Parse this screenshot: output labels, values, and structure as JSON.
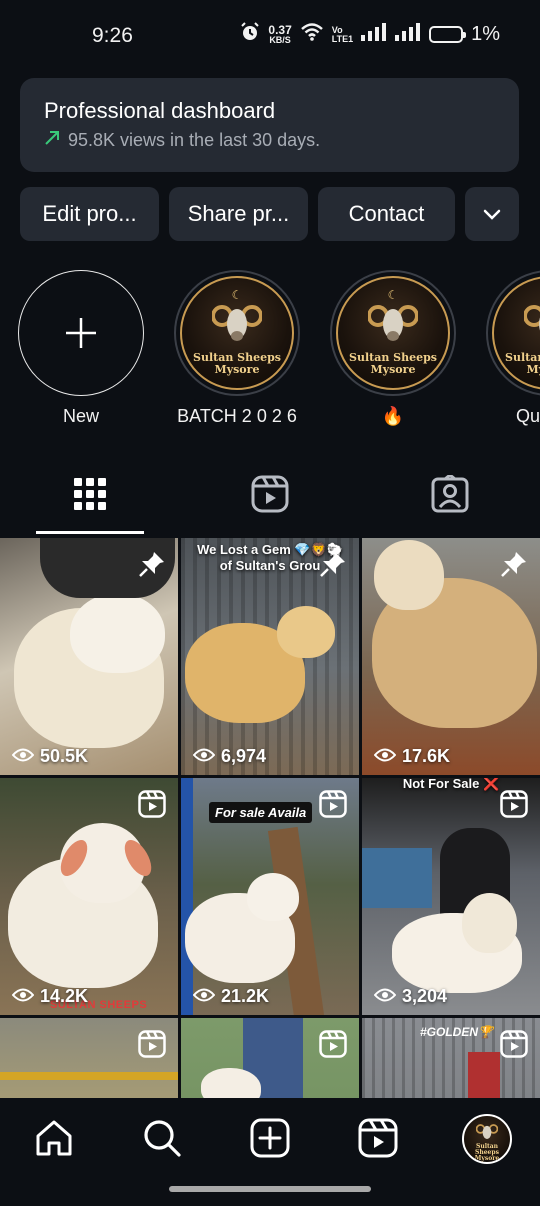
{
  "status_bar": {
    "time": "9:26",
    "net_speed_value": "0.37",
    "net_speed_unit": "KB/S",
    "volte_top": "Vo",
    "volte_mid": "LTE1",
    "volte_bot": "",
    "battery_percent": "1%"
  },
  "dashboard": {
    "title": "Professional dashboard",
    "subtitle": "95.8K views in the last 30 days.",
    "trend_icon": "trending-up-arrow",
    "accent_color": "#39c97a"
  },
  "actions": {
    "edit_label": "Edit pro...",
    "share_label": "Share pr...",
    "contact_label": "Contact"
  },
  "highlights": [
    {
      "label": "New"
    },
    {
      "label": "BATCH 2 0 2 6"
    },
    {
      "label": "🔥"
    },
    {
      "label": "Qu"
    }
  ],
  "logo_text": {
    "line1": "Sultan Sheeps",
    "line2": "Mysore"
  },
  "posts": [
    {
      "views": "50.5K",
      "badge": "pin-icon"
    },
    {
      "views": "6,974",
      "badge": "pin-icon",
      "caption_line1": "We Lost a Gem 💎🦁🐑",
      "caption_line2": "of Sultan's Grou"
    },
    {
      "views": "17.6K",
      "badge": "pin-icon"
    },
    {
      "views": "14.2K",
      "badge": "reel-icon",
      "footer": "SULTAN SHEEPS"
    },
    {
      "views": "21.2K",
      "badge": "reel-icon",
      "tag": "For sale Availa"
    },
    {
      "views": "3,204",
      "badge": "reel-icon",
      "caption_line1": "Not For Sale ❌"
    },
    {
      "views": "",
      "badge": "reel-icon"
    },
    {
      "views": "",
      "badge": "reel-icon"
    },
    {
      "views": "",
      "badge": "reel-icon",
      "tag": "#GOLDEN🏆"
    }
  ]
}
